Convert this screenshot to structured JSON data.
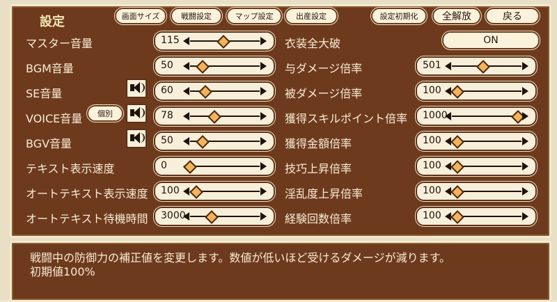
{
  "header": {
    "title": "設定",
    "tabs": [
      "画面サイズ",
      "戦闘設定",
      "マップ設定",
      "出産設定"
    ],
    "actions": [
      "設定初期化",
      "全解放",
      "戻る"
    ]
  },
  "left_settings": [
    {
      "label": "マスター音量",
      "value": "115",
      "fraction": 0.48
    },
    {
      "label": "BGM音量",
      "value": "50",
      "fraction": 0.18
    },
    {
      "label": "SE音量",
      "value": "60",
      "fraction": 0.22
    },
    {
      "label": "VOICE音量",
      "value": "78",
      "fraction": 0.35
    },
    {
      "label": "BGV音量",
      "value": "50",
      "fraction": 0.18
    },
    {
      "label": "テキスト表示速度",
      "value": "0",
      "fraction": 0.0
    },
    {
      "label": "オートテキスト表示速度",
      "value": "100",
      "fraction": 0.09
    },
    {
      "label": "オートテキスト待機時間",
      "value": "3000",
      "fraction": 0.31
    }
  ],
  "voice_individual_label": "個別",
  "right_settings": [
    {
      "label": "衣装全大破",
      "type": "toggle",
      "value": "ON"
    },
    {
      "label": "与ダメージ倍率",
      "value": "501",
      "fraction": 0.45
    },
    {
      "label": "被ダメージ倍率",
      "value": "100",
      "fraction": 0.08
    },
    {
      "label": "獲得スキルポイント倍率",
      "value": "1000",
      "fraction": 0.95
    },
    {
      "label": "獲得金額倍率",
      "value": "100",
      "fraction": 0.08
    },
    {
      "label": "技巧上昇倍率",
      "value": "100",
      "fraction": 0.08
    },
    {
      "label": "淫乱度上昇倍率",
      "value": "100",
      "fraction": 0.08
    },
    {
      "label": "経験回数倍率",
      "value": "100",
      "fraction": 0.08
    }
  ],
  "description": {
    "line1": "戦闘中の防御力の補正値を変更します。数値が低いほど受けるダメージが減ります。",
    "line2": "初期値100%"
  },
  "icons": {
    "speaker": "speaker-icon"
  }
}
